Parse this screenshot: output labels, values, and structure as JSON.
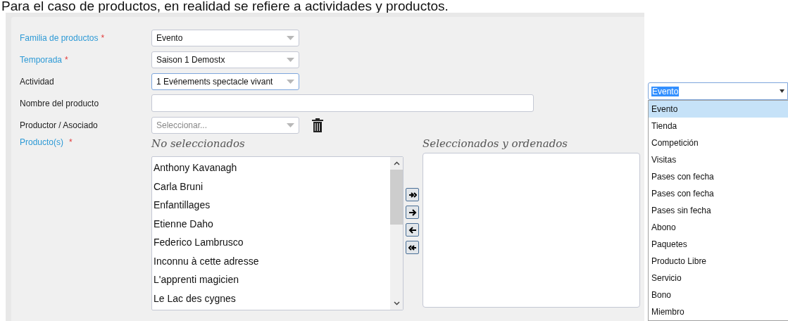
{
  "caption": "Para el caso de productos, en realidad se refiere a actividades y productos.",
  "fields": [
    {
      "label": "Familia de productos",
      "required_mark": "*",
      "kind": "select",
      "value": "Evento",
      "focused": false
    },
    {
      "label": "Temporada",
      "required_mark": "*",
      "kind": "select",
      "value": "Saison 1 Demostx",
      "focused": false
    },
    {
      "label": "Actividad",
      "kind": "select",
      "value": "1 Evénements spectacle vivant",
      "focused": true
    },
    {
      "label": "Nombre del producto",
      "kind": "text"
    },
    {
      "label": "Productor / Asociado",
      "kind": "select-delete",
      "placeholder": "Seleccionar...",
      "focused": false
    }
  ],
  "products": {
    "label": "Producto(s)",
    "required_mark": "*",
    "available_title": "No seleccionados",
    "chosen_title": "Seleccionados y ordenados",
    "available": [
      "Anthony Kavanagh",
      "Carla Bruni",
      "Enfantillages",
      "Etienne Daho",
      "Federico Lambrusco",
      "Inconnu à cette adresse",
      "L'apprenti magicien",
      "Le Lac des cygnes"
    ]
  },
  "dropdown": {
    "value": "Evento",
    "options": [
      {
        "label": "Evento",
        "selected": true
      },
      {
        "label": "Tienda",
        "selected": false
      },
      {
        "label": "Competición",
        "selected": false
      },
      {
        "label": "Visitas",
        "selected": false
      },
      {
        "label": "Pases con fecha",
        "selected": false
      },
      {
        "label": "Pases con fecha",
        "selected": false
      },
      {
        "label": "Pases sin fecha",
        "selected": false
      },
      {
        "label": "Abono",
        "selected": false
      },
      {
        "label": "Paquetes",
        "selected": false
      },
      {
        "label": "Producto Libre",
        "selected": false
      },
      {
        "label": "Servicio",
        "selected": false
      },
      {
        "label": "Bono",
        "selected": false
      },
      {
        "label": "Miembro",
        "selected": false
      }
    ]
  }
}
